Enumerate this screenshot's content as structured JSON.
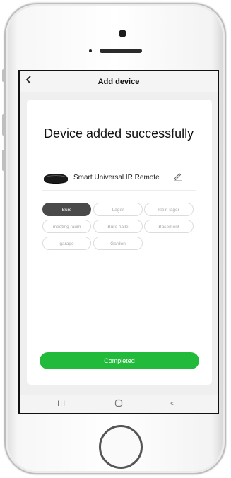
{
  "header": {
    "title": "Add device",
    "back_icon": "chevron-left-icon"
  },
  "status": {
    "headline": "Device added successfully"
  },
  "device": {
    "name": "Smart Universal IR Remote",
    "icon": "ir-remote-icon",
    "edit_icon": "pencil-icon"
  },
  "rooms": [
    {
      "label": "Buro",
      "selected": true
    },
    {
      "label": "Lager",
      "selected": false
    },
    {
      "label": "klein lager",
      "selected": false
    },
    {
      "label": "meeting raum",
      "selected": false
    },
    {
      "label": "Buro halle",
      "selected": false
    },
    {
      "label": "Basement",
      "selected": false
    },
    {
      "label": "garage",
      "selected": false
    },
    {
      "label": "Garden",
      "selected": false
    }
  ],
  "actions": {
    "complete_label": "Completed"
  },
  "navbar": {
    "recents": "III",
    "home": "O",
    "back": "<"
  },
  "colors": {
    "accent": "#21ba3b",
    "selected_chip": "#4a4a4a"
  }
}
